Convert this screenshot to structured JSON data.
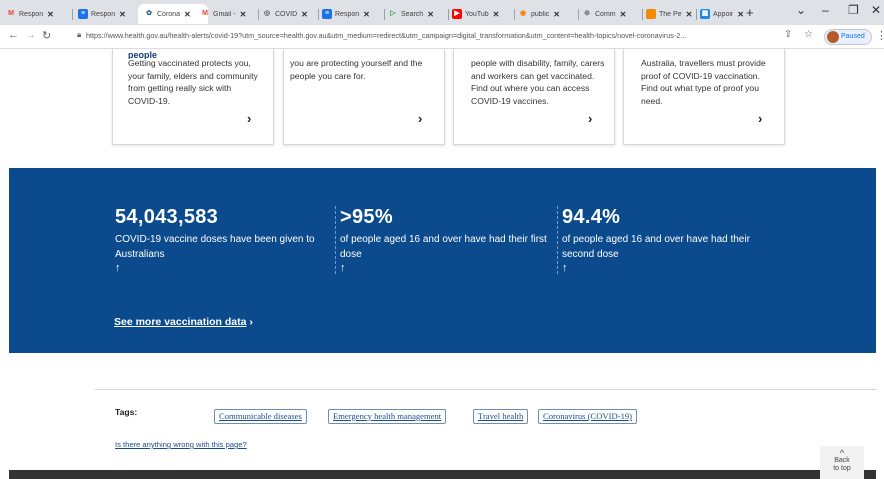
{
  "browser": {
    "tabs": [
      {
        "label": "Respon",
        "icon": "gmail-icon",
        "color": "#ea4335",
        "active": false
      },
      {
        "label": "Respon",
        "icon": "forms-icon",
        "color": "#1a73e8",
        "active": false
      },
      {
        "label": "Corona",
        "icon": "gov-crest-icon",
        "color": "#2c5f8a",
        "active": true
      },
      {
        "label": "Gmail -",
        "icon": "gmail-icon",
        "color": "#ea4335",
        "active": false
      },
      {
        "label": "COVID",
        "icon": "globe-icon",
        "color": "#555555",
        "active": false
      },
      {
        "label": "Respon",
        "icon": "forms-icon",
        "color": "#1a73e8",
        "active": false
      },
      {
        "label": "Search",
        "icon": "search-icon",
        "color": "#34a853",
        "active": false
      },
      {
        "label": "YouTub",
        "icon": "youtube-icon",
        "color": "#ff0000",
        "active": false
      },
      {
        "label": "public",
        "icon": "circle-icon",
        "color": "#f57c00",
        "active": false
      },
      {
        "label": "Comm",
        "icon": "ring-icon",
        "color": "#5f6368",
        "active": false
      },
      {
        "label": "The Pe",
        "icon": "orange-square-icon",
        "color": "#f28b00",
        "active": false
      },
      {
        "label": "Appoir",
        "icon": "calendar-icon",
        "color": "#1e88e5",
        "active": false
      }
    ],
    "url": "https://www.health.gov.au/health-alerts/covid-19?utm_source=health.gov.au&utm_medium=redirect&utm_campaign=digital_transformation&utm_content=health-topics/novel-coronavirus-2...",
    "profile_label": "Paused"
  },
  "cards": [
    {
      "title": "people",
      "text": "Getting vaccinated protects you, your family, elders and community from getting really sick with COVID-19."
    },
    {
      "title": "",
      "text": "you are protecting yourself and the people you care for."
    },
    {
      "title": "",
      "text": "people with disability, family, carers and workers can get vaccinated. Find out where you can access COVID-19 vaccines."
    },
    {
      "title": "",
      "text": "Australia, travellers must provide proof of COVID-19 vaccination. Find out what type of proof you need."
    }
  ],
  "stats": [
    {
      "value": "54,043,583",
      "desc": "COVID-19 vaccine doses have been given to Australians"
    },
    {
      "value": ">95%",
      "desc": "of people aged 16 and over have had their first dose"
    },
    {
      "value": "94.4%",
      "desc": "of people aged 16 and over have had their second dose"
    }
  ],
  "see_more": "See more vaccination data",
  "tags_label": "Tags:",
  "tags": [
    "Communicable diseases",
    "Emergency health management",
    "Travel health",
    "Coronavirus (COVID-19)"
  ],
  "wrong_link": "Is there anything wrong with this page?",
  "back_to_top": {
    "line1": "Back",
    "line2": "to top"
  },
  "colors": {
    "band": "#0b4a8c",
    "link": "#1a4d8f",
    "footer": "#333333"
  }
}
